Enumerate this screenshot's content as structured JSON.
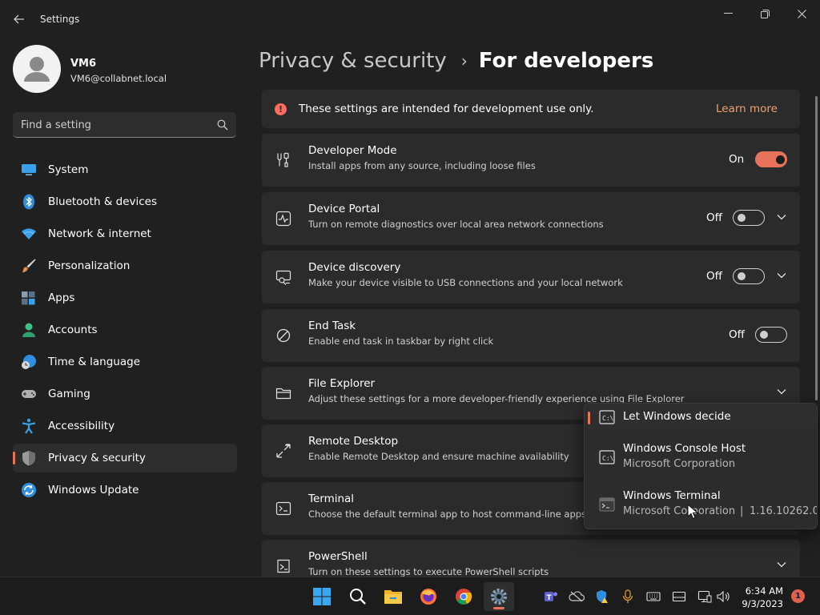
{
  "window": {
    "title": "Settings"
  },
  "profile": {
    "name": "VM6",
    "email": "VM6@collabnet.local"
  },
  "search": {
    "placeholder": "Find a setting"
  },
  "sidebar": {
    "items": [
      {
        "label": "System",
        "icon": "system-icon"
      },
      {
        "label": "Bluetooth & devices",
        "icon": "bluetooth-icon"
      },
      {
        "label": "Network & internet",
        "icon": "wifi-icon"
      },
      {
        "label": "Personalization",
        "icon": "brush-icon"
      },
      {
        "label": "Apps",
        "icon": "apps-icon"
      },
      {
        "label": "Accounts",
        "icon": "person-icon"
      },
      {
        "label": "Time & language",
        "icon": "globe-clock-icon"
      },
      {
        "label": "Gaming",
        "icon": "gamepad-icon"
      },
      {
        "label": "Accessibility",
        "icon": "accessibility-icon"
      },
      {
        "label": "Privacy & security",
        "icon": "shield-icon",
        "active": true
      },
      {
        "label": "Windows Update",
        "icon": "update-icon"
      }
    ]
  },
  "breadcrumb": {
    "parent": "Privacy & security",
    "separator": "›",
    "current": "For developers"
  },
  "banner": {
    "text": "These settings are intended for development use only.",
    "link": "Learn more"
  },
  "settings": [
    {
      "title": "Developer Mode",
      "desc": "Install apps from any source, including loose files",
      "state": "On",
      "icon": "developer-tools-icon"
    },
    {
      "title": "Device Portal",
      "desc": "Turn on remote diagnostics over local area network connections",
      "state": "Off",
      "icon": "pulse-icon"
    },
    {
      "title": "Device discovery",
      "desc": "Make your device visible to USB connections and your local network",
      "state": "Off",
      "icon": "device-search-icon"
    },
    {
      "title": "End Task",
      "desc": "Enable end task in taskbar by right click",
      "state": "Off",
      "icon": "prohibited-icon"
    },
    {
      "title": "File Explorer",
      "desc": "Adjust these settings for a more developer-friendly experience using File Explorer",
      "icon": "folder-icon"
    },
    {
      "title": "Remote Desktop",
      "desc": "Enable Remote Desktop and ensure machine availability",
      "icon": "remote-desktop-icon"
    },
    {
      "title": "Terminal",
      "desc": "Choose the default terminal app to host command-line apps",
      "icon": "terminal-icon"
    },
    {
      "title": "PowerShell",
      "desc": "Turn on these settings to execute PowerShell scripts",
      "icon": "powershell-icon"
    }
  ],
  "terminal_dropdown": {
    "options": [
      {
        "title": "Let Windows decide",
        "selected": true
      },
      {
        "title": "Windows Console Host",
        "publisher": "Microsoft Corporation"
      },
      {
        "title": "Windows Terminal",
        "publisher": "Microsoft Corporation",
        "separator": "|",
        "version": "1.16.10262.0"
      }
    ]
  },
  "taskbar": {
    "time": "6:34 AM",
    "date": "9/3/2023",
    "notifications": "1"
  },
  "colors": {
    "accent": "#e9735a",
    "background": "#202020",
    "card": "#2b2b2b",
    "warning": "#ff6b60",
    "link": "#f0a070"
  }
}
